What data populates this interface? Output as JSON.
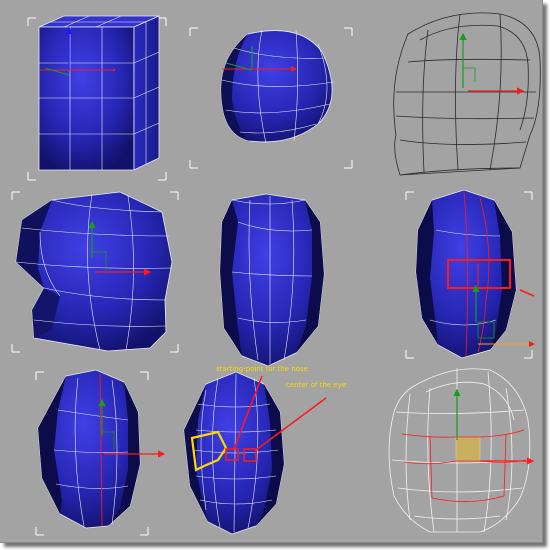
{
  "figure": {
    "annotations": {
      "nose": "starting-point for the nose",
      "eye": "center of the eye"
    },
    "colors": {
      "background": "#a3a3a3",
      "mesh_fill": "#2424b2",
      "mesh_highlight": "#3b3bdd",
      "mesh_dark": "#08083a",
      "wire": "#e9e9f5",
      "wire_dark": "#202020",
      "selection": "#ff0000",
      "annotation": "#ffd800",
      "axis_x": "#ff1a1a",
      "axis_y": "#1a9c1a",
      "axis_z": "#1a1aff",
      "face_highlight": "#c8b060"
    },
    "panels": [
      {
        "name": "panel-box-start",
        "shape": "box"
      },
      {
        "name": "panel-sphere-meshsmooth",
        "shape": "sphere"
      },
      {
        "name": "panel-head-wireframe-side",
        "shape": "wireframe-side"
      },
      {
        "name": "panel-head-side-shaded",
        "shape": "head-side"
      },
      {
        "name": "panel-head-front-shaded",
        "shape": "head-front"
      },
      {
        "name": "panel-head-front-selection",
        "shape": "head-selection"
      },
      {
        "name": "panel-head-front-cut",
        "shape": "head-cut"
      },
      {
        "name": "panel-head-nose-eye-marked",
        "shape": "head-annotated"
      },
      {
        "name": "panel-head-wireframe-front",
        "shape": "wireframe-front"
      }
    ]
  }
}
